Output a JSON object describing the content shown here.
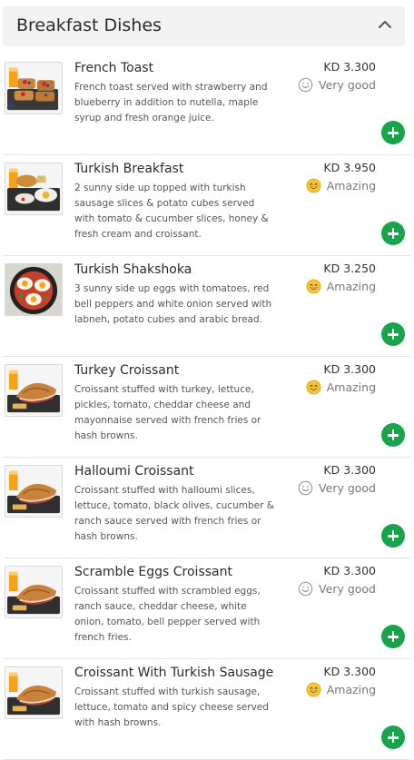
{
  "section": {
    "title": "Breakfast Dishes",
    "collapse_icon": "chevron-up-icon"
  },
  "colors": {
    "add_button": "#19a34a",
    "header_bg": "#f2f2f2"
  },
  "items": [
    {
      "name": "French Toast",
      "description": "French toast served with strawberry and blueberry in addition to nutella, maple syrup and fresh orange juice.",
      "price": "KD 3.300",
      "rating": "Very good",
      "rating_icon": "smile-outline-icon",
      "image_icon": "french-toast-image"
    },
    {
      "name": "Turkish Breakfast",
      "description": "2 sunny side up topped with turkish sausage slices & potato cubes served with tomato & cucumber slices, honey & fresh cream and croissant.",
      "price": "KD 3.950",
      "rating": "Amazing",
      "rating_icon": "grin-emoji-icon",
      "image_icon": "turkish-breakfast-image"
    },
    {
      "name": "Turkish Shakshoka",
      "description": "3 sunny side up eggs with tomatoes, red bell peppers and white onion served with labneh, potato cubes and arabic bread.",
      "price": "KD 3.250",
      "rating": "Amazing",
      "rating_icon": "grin-emoji-icon",
      "image_icon": "shakshoka-image"
    },
    {
      "name": "Turkey Croissant",
      "description": "Croissant stuffed with turkey, lettuce, pickles, tomato, cheddar cheese and mayonnaise served with french fries or hash browns.",
      "price": "KD 3.300",
      "rating": "Amazing",
      "rating_icon": "grin-emoji-icon",
      "image_icon": "croissant-image"
    },
    {
      "name": "Halloumi Croissant",
      "description": "Croissant stuffed with halloumi slices, lettuce, tomato, black olives, cucumber & ranch sauce served with french fries or hash browns.",
      "price": "KD 3.300",
      "rating": "Very good",
      "rating_icon": "smile-outline-icon",
      "image_icon": "croissant-image"
    },
    {
      "name": "Scramble Eggs Croissant",
      "description": "Croissant stuffed with scrambled eggs, ranch sauce, cheddar cheese, white onion, tomato, bell pepper served with french fries.",
      "price": "KD 3.300",
      "rating": "Very good",
      "rating_icon": "smile-outline-icon",
      "image_icon": "croissant-image"
    },
    {
      "name": "Croissant With Turkish Sausage",
      "description": "Croissant stuffed with turkish sausage, lettuce, tomato and spicy cheese served with hash browns.",
      "price": "KD 3.300",
      "rating": "Amazing",
      "rating_icon": "grin-emoji-icon",
      "image_icon": "croissant-image"
    }
  ]
}
